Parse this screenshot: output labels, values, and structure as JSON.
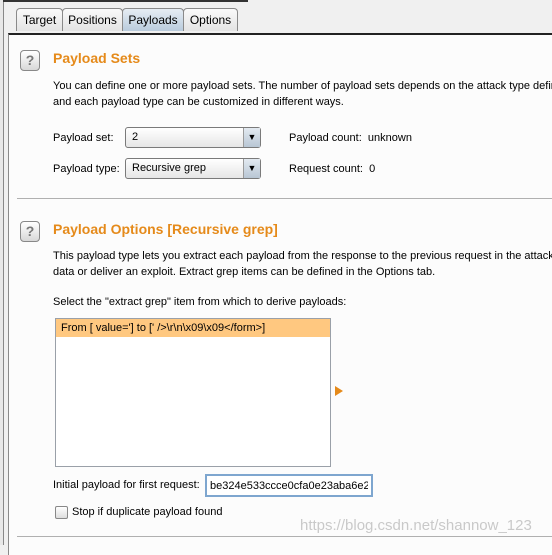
{
  "tabs": [
    {
      "label": "Target"
    },
    {
      "label": "Positions"
    },
    {
      "label": "Payloads"
    },
    {
      "label": "Options"
    }
  ],
  "active_tab": "Payloads",
  "payload_sets": {
    "title": "Payload Sets",
    "desc_line1": "You can define one or more payload sets. The number of payload sets depends on the attack type defin",
    "desc_line2": "and each payload type can be customized in different ways.",
    "set_label": "Payload set:",
    "set_value": "2",
    "type_label": "Payload type:",
    "type_value": "Recursive grep",
    "payload_count_label": "Payload count:",
    "payload_count_value": "unknown",
    "request_count_label": "Request count:",
    "request_count_value": "0"
  },
  "payload_options": {
    "title": "Payload Options [Recursive grep]",
    "desc_line1": "This payload type lets you extract each payload from the response to the previous request in the attack",
    "desc_line2": "data or deliver an exploit. Extract grep items can be defined in the Options tab.",
    "select_label": "Select the \"extract grep\" item from which to derive payloads:",
    "items": [
      {
        "label": "From [ value='] to [' />\\r\\n\\x09\\x09</form>]",
        "selected": true
      }
    ],
    "initial_label": "Initial payload for first request:",
    "initial_value": "be324e533ccce0cfa0e23aba6e2",
    "stop_label": "Stop if duplicate payload found",
    "stop_checked": false
  },
  "watermark": "https://blog.csdn.net/shannow_123",
  "colors": {
    "accent": "#e58a1a",
    "selection": "#ffc880"
  }
}
